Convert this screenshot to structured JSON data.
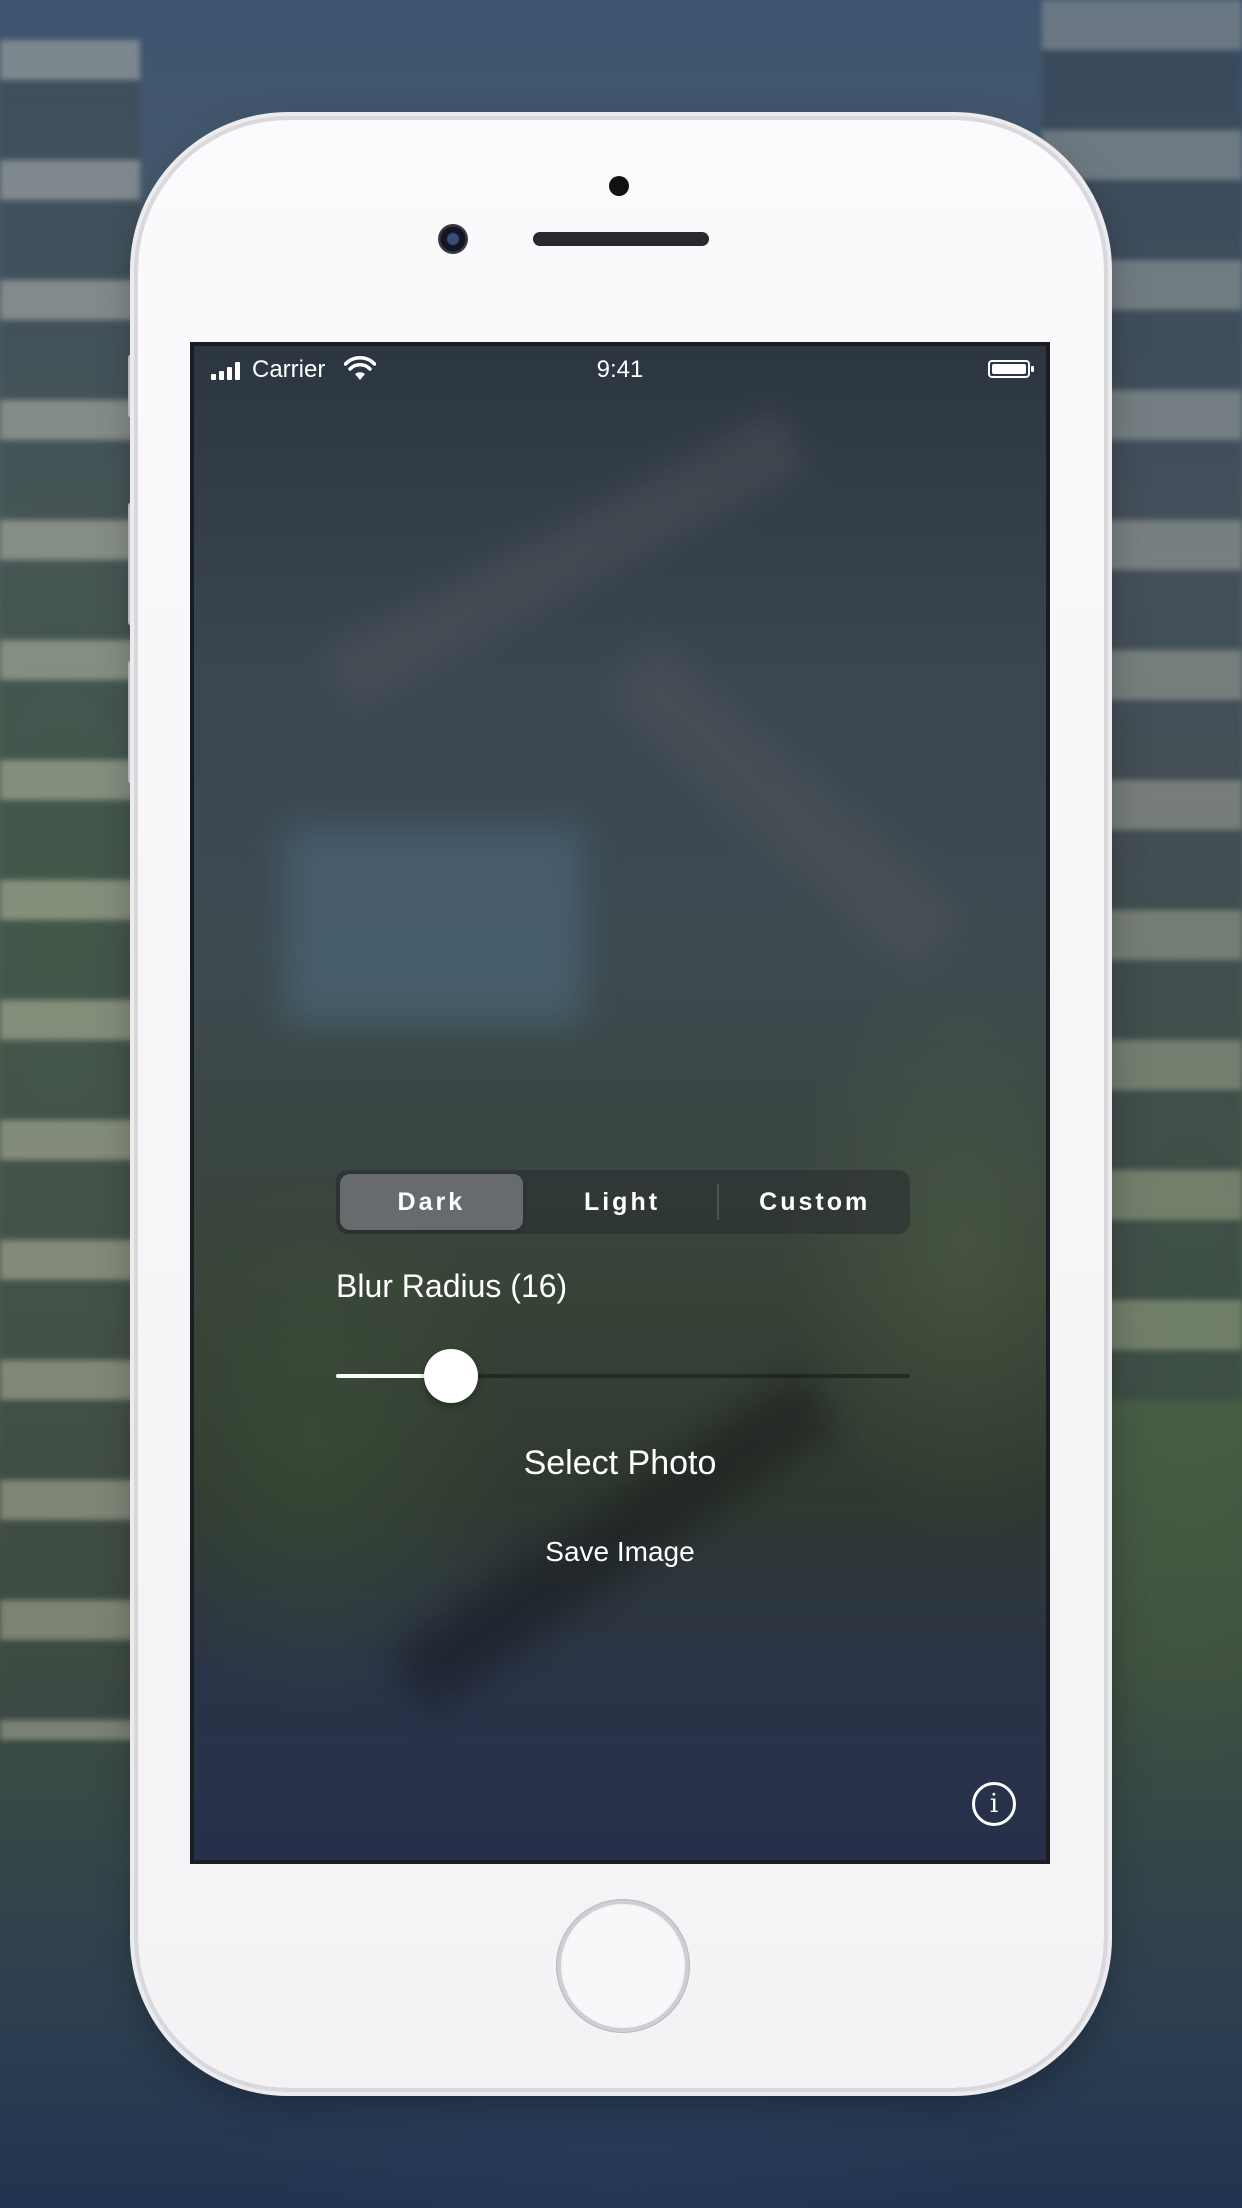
{
  "status_bar": {
    "carrier": "Carrier",
    "time": "9:41"
  },
  "segmented_control": {
    "options": [
      "Dark",
      "Light",
      "Custom"
    ],
    "selected": "Dark"
  },
  "blur": {
    "label": "Blur Radius (16)",
    "slider_fraction": 0.2
  },
  "actions": {
    "select_photo": "Select Photo",
    "save_image": "Save Image",
    "info_glyph": "i"
  },
  "colors": {
    "accent": "#ffffff"
  }
}
